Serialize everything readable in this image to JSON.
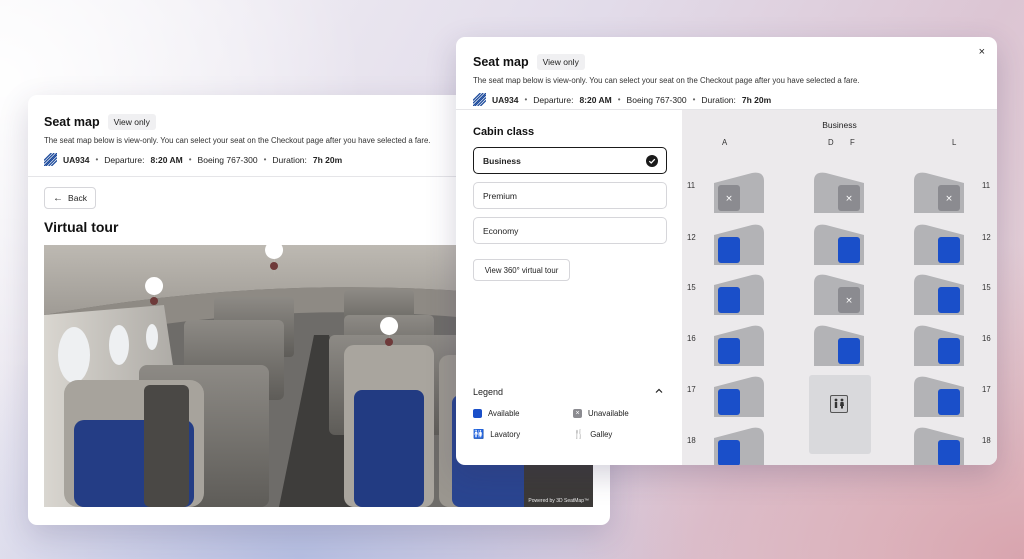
{
  "colors": {
    "available": "#1a4fc9",
    "unavailable": "#8b8b90",
    "seat_shell": "#b3b3b6",
    "accent": "#1a1a1a"
  },
  "back_card": {
    "title": "Seat map",
    "badge": "View only",
    "subtitle": "The seat map below is view-only. You can select your seat on the Checkout page after you have selected a fare.",
    "flight": {
      "number": "UA934",
      "departure_label": "Departure:",
      "departure_time": "8:20 AM",
      "aircraft": "Boeing 767-300",
      "duration_label": "Duration:",
      "duration": "7h 20m"
    },
    "back_button": "Back",
    "section_title": "Virtual tour",
    "powered_by": "Powered by 3D SeatMap™"
  },
  "front_card": {
    "title": "Seat map",
    "badge": "View only",
    "subtitle": "The seat map below is view-only. You can select your seat on the Checkout page after you have selected a fare.",
    "flight": {
      "number": "UA934",
      "departure_label": "Departure:",
      "departure_time": "8:20 AM",
      "aircraft": "Boeing 767-300",
      "duration_label": "Duration:",
      "duration": "7h 20m"
    },
    "close_icon": "×",
    "cabin_class_title": "Cabin class",
    "cabin_options": [
      {
        "label": "Business",
        "selected": true
      },
      {
        "label": "Premium",
        "selected": false
      },
      {
        "label": "Economy",
        "selected": false
      }
    ],
    "tour_button": "View 360° virtual tour",
    "legend": {
      "title": "Legend",
      "items": [
        {
          "label": "Available",
          "icon": "available-swatch"
        },
        {
          "label": "Unavailable",
          "icon": "unavailable-swatch"
        },
        {
          "label": "Lavatory",
          "icon": "lavatory-icon"
        },
        {
          "label": "Galley",
          "icon": "galley-icon"
        }
      ]
    }
  },
  "seat_map": {
    "cabin": "Business",
    "columns": [
      "A",
      "D",
      "F",
      "L"
    ],
    "rows": [
      "11",
      "12",
      "15",
      "16",
      "17",
      "18"
    ],
    "seats": [
      {
        "row": "11",
        "A": "unavailable",
        "D": "unavailable",
        "F": "available",
        "L": "unavailable"
      },
      {
        "row": "12",
        "A": "available",
        "D": "available",
        "F": "unavailable",
        "L": "available"
      },
      {
        "row": "15",
        "A": "available",
        "D": "unavailable",
        "F": "available",
        "L": "available"
      },
      {
        "row": "16",
        "A": "available",
        "D": "available",
        "F": "unavailable",
        "L": "available"
      },
      {
        "row": "17",
        "A": "available",
        "L": "available"
      },
      {
        "row": "18",
        "A": "available",
        "L": "available"
      }
    ],
    "lavatory_rows": [
      "17",
      "18"
    ]
  }
}
